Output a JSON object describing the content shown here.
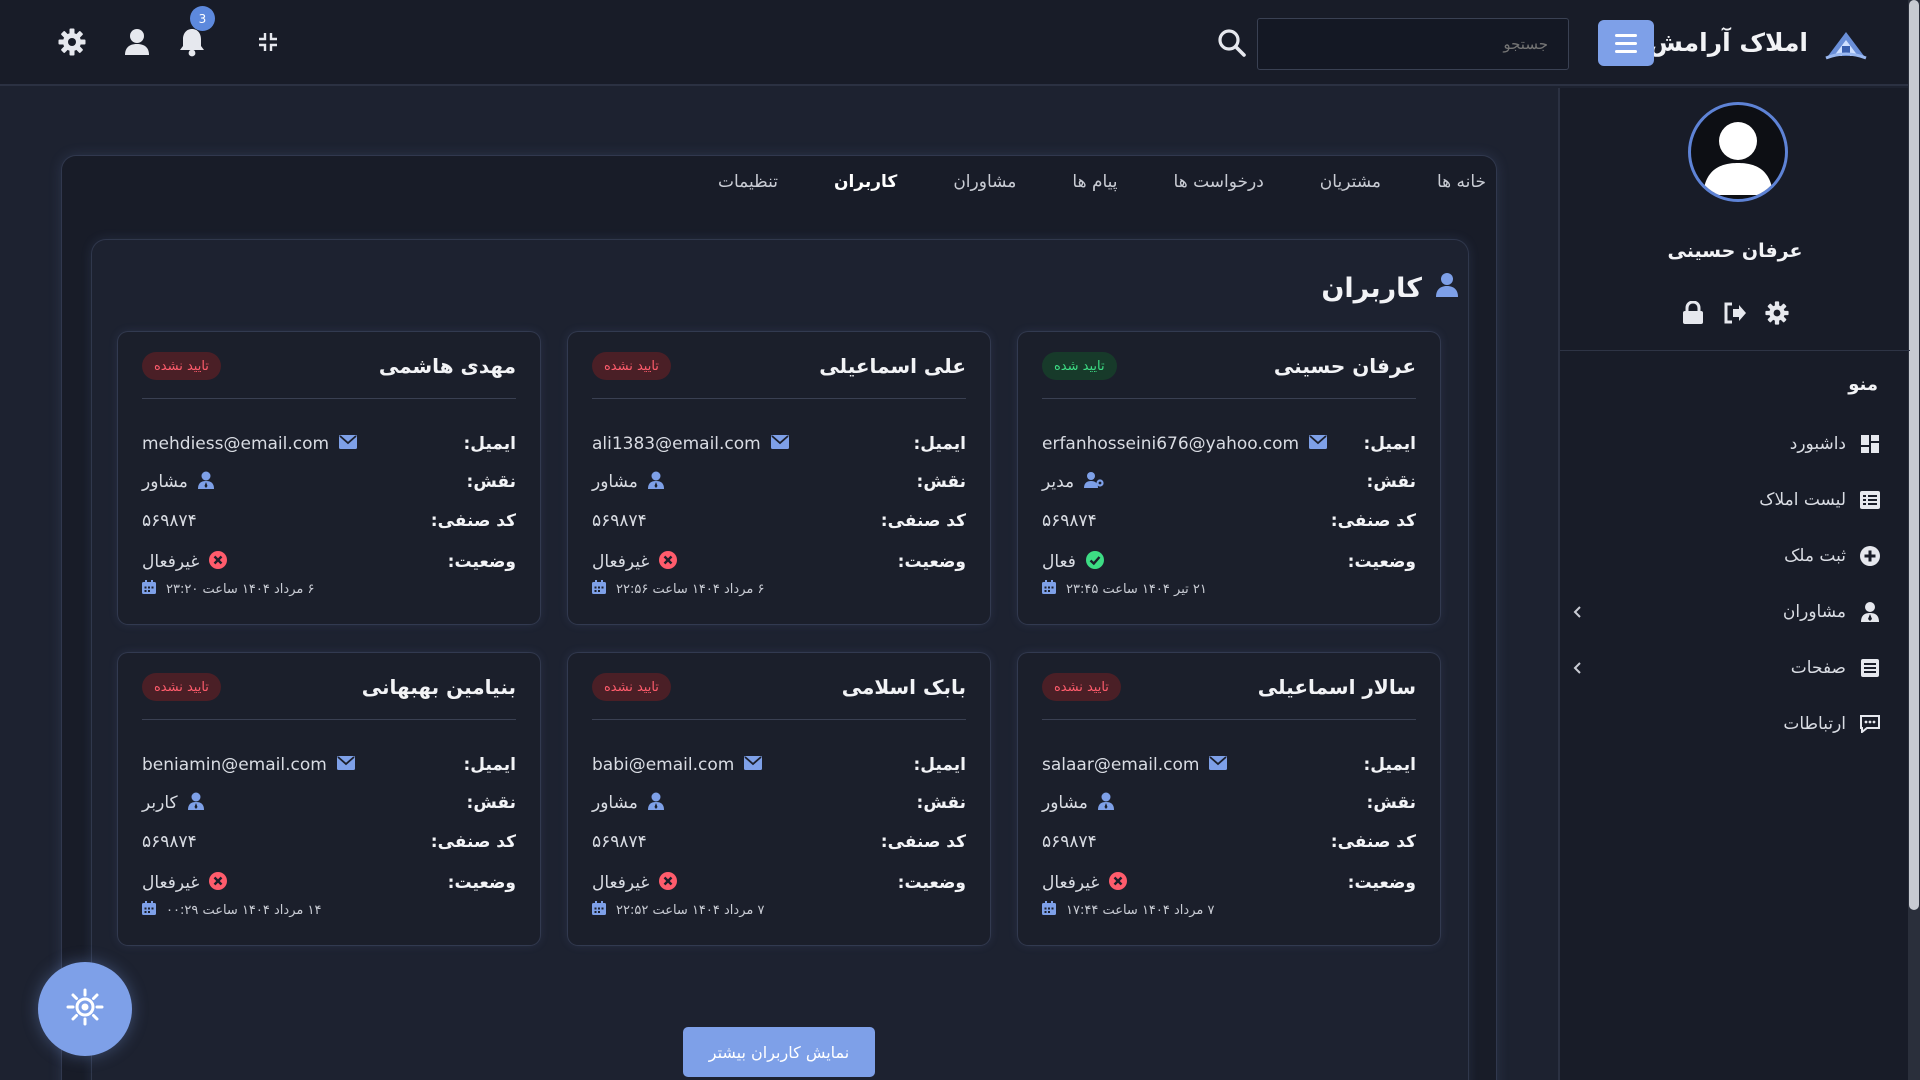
{
  "header": {
    "brand_title": "املاک آرامش",
    "search_placeholder": "جستجو",
    "notification_count": "3",
    "icons": [
      "logo-icon",
      "menu-icon",
      "search-icon",
      "fullscreen-exit-icon",
      "bell-icon",
      "user-icon",
      "gear-icon"
    ]
  },
  "sidebar": {
    "profile_name": "عرفان حسینی",
    "menu_title": "منو",
    "items": [
      {
        "label": "داشبورد",
        "icon": "dashboard-icon"
      },
      {
        "label": "لیست املاک",
        "icon": "list-icon"
      },
      {
        "label": "ثبت ملک",
        "icon": "plus-circle-icon"
      },
      {
        "label": "مشاوران",
        "icon": "advisors-icon",
        "has_submenu": true
      },
      {
        "label": "صفحات",
        "icon": "pages-icon",
        "has_submenu": true
      },
      {
        "label": "ارتباطات",
        "icon": "chat-icon"
      }
    ]
  },
  "tabs": [
    {
      "label": "خانه ها",
      "active": false
    },
    {
      "label": "مشتریان",
      "active": false
    },
    {
      "label": "درخواست ها",
      "active": false
    },
    {
      "label": "پیام ها",
      "active": false
    },
    {
      "label": "مشاوران",
      "active": false
    },
    {
      "label": "کاربران",
      "active": true
    },
    {
      "label": "تنظیمات",
      "active": false
    }
  ],
  "section_title": "کاربران",
  "labels": {
    "email": "ایمیل:",
    "role": "نقش:",
    "code": "کد صنفی:",
    "status": "وضعیت:"
  },
  "users": [
    {
      "name": "عرفان حسینی",
      "badge": "تایید شده",
      "verified": true,
      "email": "erfanhosseini676@yahoo.com",
      "role": "مدیر",
      "code": "۵۶۹۸۷۴",
      "status": "فعال",
      "active": true,
      "date": "۲۱ تیر ۱۴۰۴ ساعت ۲۳:۴۵"
    },
    {
      "name": "علی اسماعیلی",
      "badge": "تایید نشده",
      "verified": false,
      "email": "ali1383@email.com",
      "role": "مشاور",
      "code": "۵۶۹۸۷۴",
      "status": "غیرفعال",
      "active": false,
      "date": "۶ مرداد ۱۴۰۴ ساعت ۲۲:۵۶"
    },
    {
      "name": "مهدی هاشمی",
      "badge": "تایید نشده",
      "verified": false,
      "email": "mehdiess@email.com",
      "role": "مشاور",
      "code": "۵۶۹۸۷۴",
      "status": "غیرفعال",
      "active": false,
      "date": "۶ مرداد ۱۴۰۴ ساعت ۲۳:۲۰"
    },
    {
      "name": "سالار اسماعیلی",
      "badge": "تایید نشده",
      "verified": false,
      "email": "salaar@email.com",
      "role": "مشاور",
      "code": "۵۶۹۸۷۴",
      "status": "غیرفعال",
      "active": false,
      "date": "۷ مرداد ۱۴۰۴ ساعت ۱۷:۴۴"
    },
    {
      "name": "بابک اسلامی",
      "badge": "تایید نشده",
      "verified": false,
      "email": "babi@email.com",
      "role": "مشاور",
      "code": "۵۶۹۸۷۴",
      "status": "غیرفعال",
      "active": false,
      "date": "۷ مرداد ۱۴۰۴ ساعت ۲۲:۵۲"
    },
    {
      "name": "بنیامین بهبهانی",
      "badge": "تایید نشده",
      "verified": false,
      "email": "beniamin@email.com",
      "role": "کاربر",
      "code": "۵۶۹۸۷۴",
      "status": "غیرفعال",
      "active": false,
      "date": "۱۴ مرداد ۱۴۰۴ ساعت ۰۰:۲۹"
    }
  ],
  "more_button_label": "نمایش کاربران بیشتر",
  "colors": {
    "accent": "#7ea0e8",
    "background": "#1d2230",
    "surface": "#181c28",
    "verified": "#3ddc84",
    "unverified": "#ff5c6c"
  }
}
